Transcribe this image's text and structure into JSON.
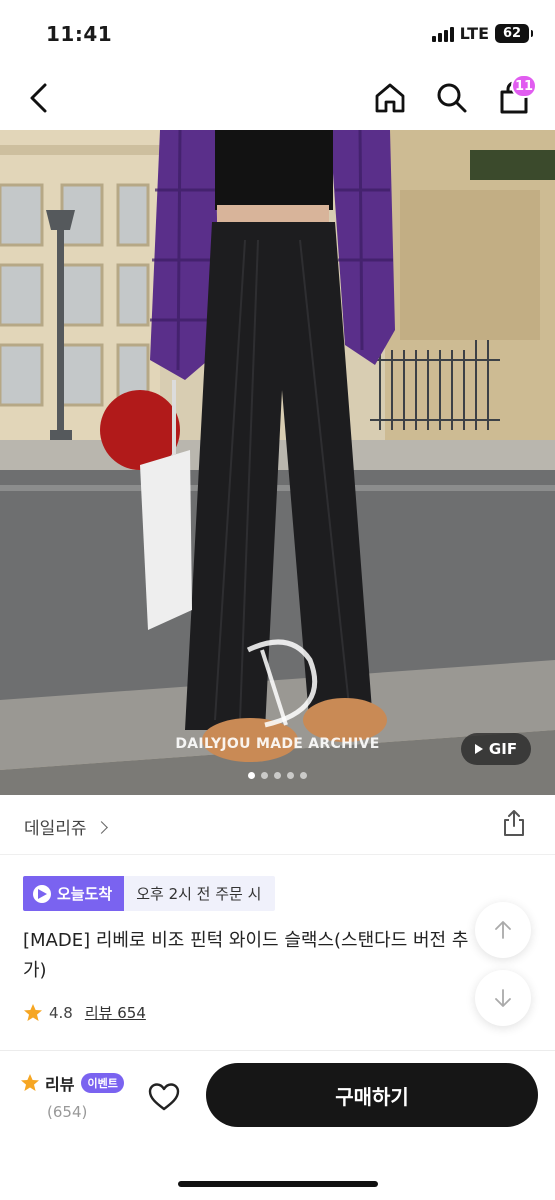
{
  "status_bar": {
    "time": "11:41",
    "network": "LTE",
    "battery": "62"
  },
  "nav": {
    "cart_count": "11"
  },
  "hero": {
    "watermark": "DAILYJOU MADE ARCHIVE",
    "gif_label": "GIF",
    "pages_total": 5,
    "current_page": 1
  },
  "brand": {
    "name": "데일리쥬"
  },
  "delivery": {
    "badge": "오늘도착",
    "cutoff": "오후 2시 전 주문 시"
  },
  "product": {
    "title_line1": "[MADE] 리베로 비조 핀턱 와이드 슬랙스(스탠다드 버전 추",
    "title_line2": "가)",
    "rating": "4.8",
    "reviews_link": "리뷰 654"
  },
  "bottom": {
    "review_label": "리뷰",
    "event_label": "이벤트",
    "review_count": "(654)",
    "buy_label": "구매하기"
  },
  "colors": {
    "accent": "#7a63f0",
    "badge": "#e15df0",
    "star": "#f6a623",
    "button": "#161616"
  },
  "icons": [
    "back-icon",
    "home-icon",
    "search-icon",
    "bag-icon",
    "share-icon",
    "arrow-up-icon",
    "arrow-down-icon",
    "heart-icon",
    "star-icon"
  ]
}
